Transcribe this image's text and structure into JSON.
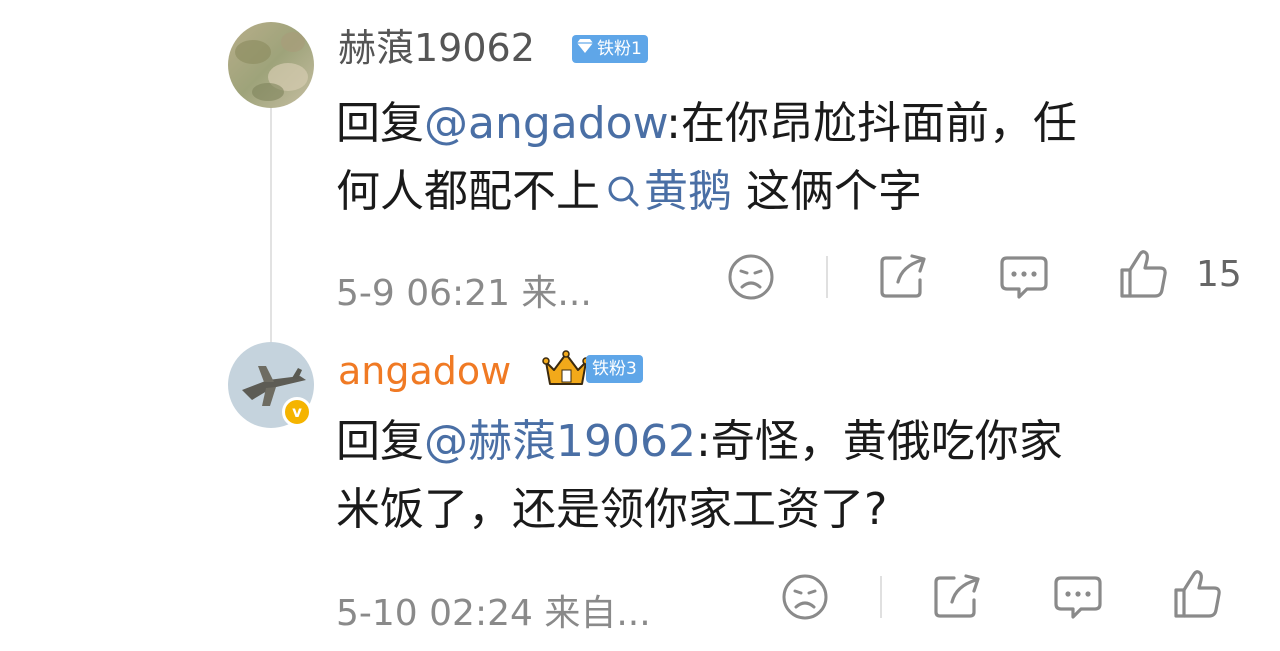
{
  "comments": [
    {
      "username": "赫蒗19062",
      "fan_badge": "铁粉1",
      "reply_prefix": "回复",
      "mention": "@angadow",
      "text_part1": ":在你昂尬抖面前，任",
      "text_part2": "何人都配不上",
      "topic": "黄鹅",
      "text_part3": " 这俩个字",
      "meta": "5-9 06:21  来...",
      "like_count": "15"
    },
    {
      "username": "angadow",
      "fan_badge": "铁粉3",
      "verified_badge": "v",
      "reply_prefix": "回复",
      "mention": "@赫蒗19062",
      "text_part1": ":奇怪，黄俄吃你家",
      "text_part2": "米饭了，还是领你家工资了?",
      "meta": "5-10 02:24  来自...",
      "like_count": ""
    }
  ],
  "colors": {
    "mention": "#4a6fa5",
    "username_vip": "#f07a24",
    "fan_badge_bg": "#5fa6e8",
    "verified": "#f5b400"
  }
}
